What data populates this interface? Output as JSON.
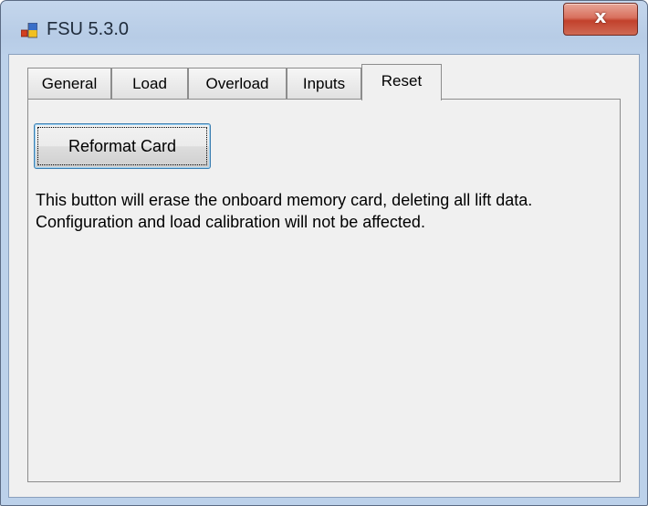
{
  "window": {
    "title": "FSU 5.3.0",
    "close_label": "x"
  },
  "tabs": [
    {
      "label": "General"
    },
    {
      "label": "Load"
    },
    {
      "label": "Overload"
    },
    {
      "label": "Inputs"
    },
    {
      "label": "Reset",
      "selected": true
    }
  ],
  "reset_panel": {
    "button_label": "Reformat Card",
    "description_line1": "This button will erase the onboard memory card, deleting all lift data.",
    "description_line2": "Configuration and load calibration will not be affected."
  },
  "icons": {
    "app": "application-icon",
    "close": "close-icon"
  },
  "colors": {
    "close_button": "#c2412c",
    "focus_border": "#3c7fb1",
    "panel_bg": "#f0f0f0"
  }
}
